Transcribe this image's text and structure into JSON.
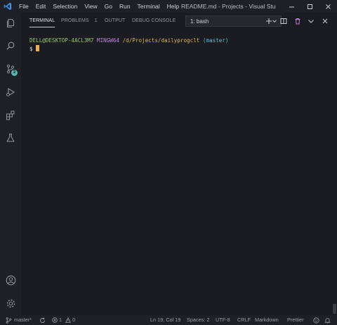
{
  "window": {
    "title": "README.md - Projects - Visual Studio ...",
    "menu": [
      "File",
      "Edit",
      "Selection",
      "View",
      "Go",
      "Run",
      "Terminal",
      "Help"
    ],
    "controls": [
      "minimize-icon",
      "maximize-icon",
      "close-icon"
    ]
  },
  "activity_bar": {
    "items": [
      {
        "icon": "explorer-icon"
      },
      {
        "icon": "search-icon"
      },
      {
        "icon": "source-control-icon",
        "badge": "2"
      },
      {
        "icon": "run-debug-icon"
      },
      {
        "icon": "extensions-icon"
      },
      {
        "icon": "testing-flask-icon"
      }
    ],
    "bottom": [
      {
        "icon": "account-icon"
      },
      {
        "icon": "settings-gear-icon"
      }
    ]
  },
  "panel": {
    "tabs": [
      {
        "label": "TERMINAL",
        "active": true
      },
      {
        "label": "PROBLEMS",
        "count": "1"
      },
      {
        "label": "OUTPUT"
      },
      {
        "label": "DEBUG CONSOLE"
      }
    ],
    "terminal_select": "1: bash",
    "tools": [
      "add-terminal-icon",
      "split-terminal-icon",
      "kill-terminal-icon",
      "collapse-panel-icon",
      "close-panel-icon"
    ]
  },
  "terminal": {
    "user": "DELL@DESKTOP-4ACL3M7",
    "system": "MINGW64",
    "path": "/d/Projects/dailyprogclt",
    "branch": "(master)",
    "prompt": "$"
  },
  "status_bar": {
    "branch": "master*",
    "errors": "1",
    "warnings": "0",
    "position": "Ln 19, Col 19",
    "spaces": "Spaces: 2",
    "encoding": "UTF-8",
    "eol": "CRLF",
    "language": "Markdown",
    "formatter": "Prettier"
  },
  "colors": {
    "background": "#1a1c22",
    "accent": "#3f8ce0",
    "prompt_user": "#94c46a",
    "prompt_system": "#c080e0",
    "prompt_path": "#d4b84a",
    "prompt_branch": "#5bbccc",
    "cursor": "#e5b54a"
  }
}
